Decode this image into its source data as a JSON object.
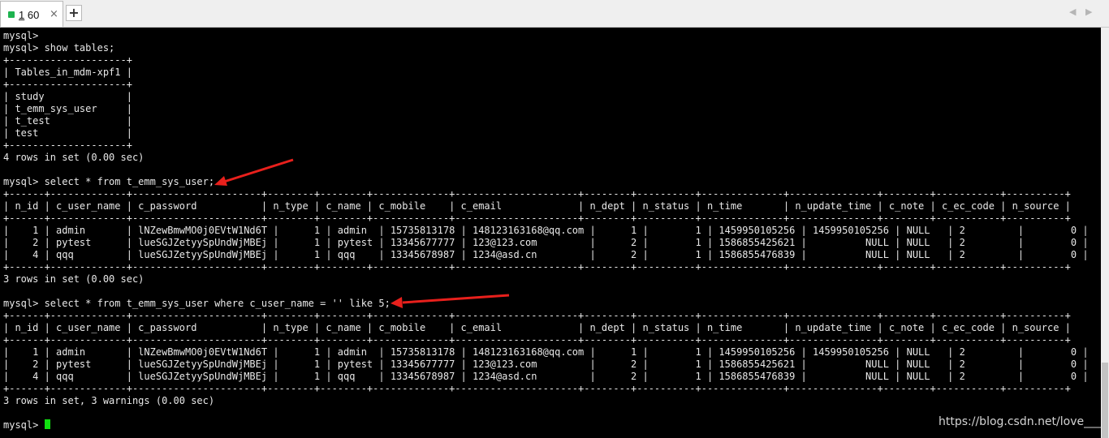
{
  "tab": {
    "number": "1",
    "title": "60",
    "close": "×",
    "add": "+"
  },
  "nav": {
    "prev": "◀",
    "next": "▶"
  },
  "terminal_lines": [
    "mysql>",
    "mysql> show tables;",
    "+--------------------+",
    "| Tables_in_mdm-xpf1 |",
    "+--------------------+",
    "| study              |",
    "| t_emm_sys_user     |",
    "| t_test             |",
    "| test               |",
    "+--------------------+",
    "4 rows in set (0.00 sec)",
    "",
    "mysql> select * from t_emm_sys_user;",
    "+------+-------------+----------------------+--------+--------+-------------+---------------------+--------+----------+--------------+---------------+--------+-----------+----------+",
    "| n_id | c_user_name | c_password           | n_type | c_name | c_mobile    | c_email             | n_dept | n_status | n_time       | n_update_time | c_note | c_ec_code | n_source |",
    "+------+-------------+----------------------+--------+--------+-------------+---------------------+--------+----------+--------------+---------------+--------+-----------+----------+",
    "|    1 | admin       | lNZewBmwMO0j0EVtW1Nd6T |      1 | admin  | 15735813178 | 148123163168@qq.com |      1 |        1 | 1459950105256 | 1459950105256 | NULL   | 2         |        0 |",
    "|    2 | pytest      | lueSGJZetyySpUndWjMBEj |      1 | pytest | 13345677777 | 123@123.com         |      2 |        1 | 1586855425621 |          NULL | NULL   | 2         |        0 |",
    "|    4 | qqq         | lueSGJZetyySpUndWjMBEj |      1 | qqq    | 13345678987 | 1234@asd.cn         |      2 |        1 | 1586855476839 |          NULL | NULL   | 2         |        0 |",
    "+------+-------------+----------------------+--------+--------+-------------+---------------------+--------+----------+--------------+---------------+--------+-----------+----------+",
    "3 rows in set (0.00 sec)",
    "",
    "mysql> select * from t_emm_sys_user where c_user_name = '' like 5;",
    "+------+-------------+----------------------+--------+--------+-------------+---------------------+--------+----------+--------------+---------------+--------+-----------+----------+",
    "| n_id | c_user_name | c_password           | n_type | c_name | c_mobile    | c_email             | n_dept | n_status | n_time       | n_update_time | c_note | c_ec_code | n_source |",
    "+------+-------------+----------------------+--------+--------+-------------+---------------------+--------+----------+--------------+---------------+--------+-----------+----------+",
    "|    1 | admin       | lNZewBmwMO0j0EVtW1Nd6T |      1 | admin  | 15735813178 | 148123163168@qq.com |      1 |        1 | 1459950105256 | 1459950105256 | NULL   | 2         |        0 |",
    "|    2 | pytest      | lueSGJZetyySpUndWjMBEj |      1 | pytest | 13345677777 | 123@123.com         |      2 |        1 | 1586855425621 |          NULL | NULL   | 2         |        0 |",
    "|    4 | qqq         | lueSGJZetyySpUndWjMBEj |      1 | qqq    | 13345678987 | 1234@asd.cn         |      2 |        1 | 1586855476839 |          NULL | NULL   | 2         |        0 |",
    "+------+-------------+----------------------+--------+--------+-------------+---------------------+--------+----------+--------------+---------------+--------+-----------+----------+",
    "3 rows in set, 3 warnings (0.00 sec)",
    "",
    "mysql> "
  ],
  "watermark": "https://blog.csdn.net/love___",
  "colors": {
    "arrow": "#e8201c",
    "cursor": "#10e010",
    "tab_indicator": "#1db34f"
  }
}
